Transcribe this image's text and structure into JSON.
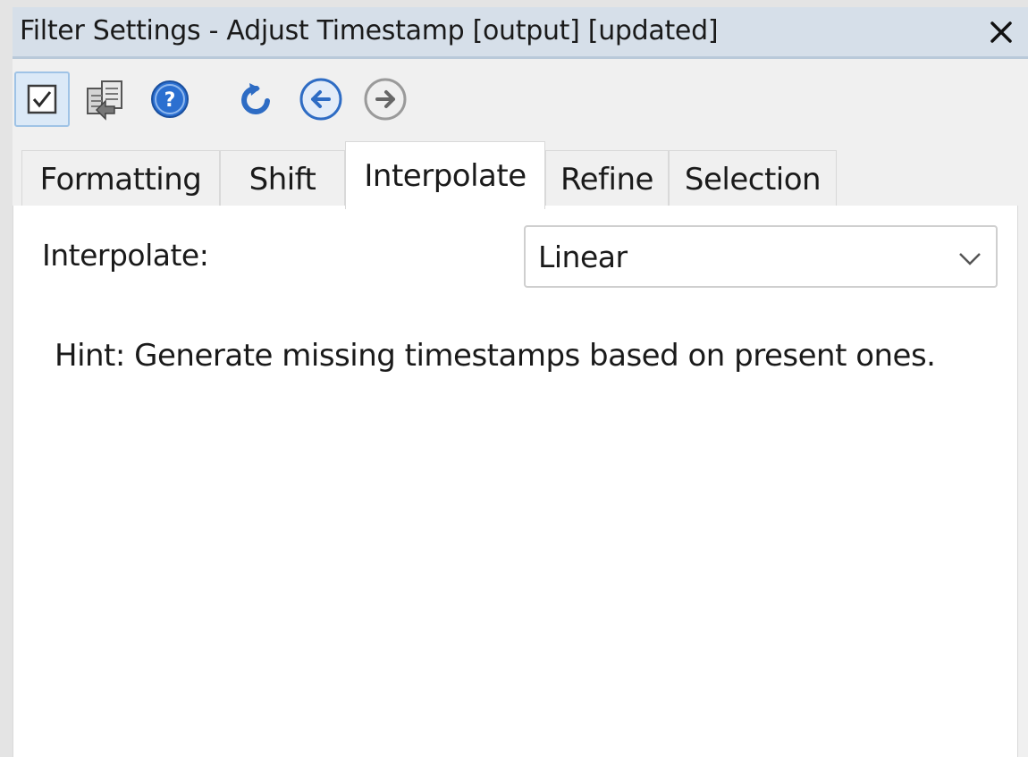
{
  "window": {
    "title": "Filter Settings - Adjust Timestamp [output] [updated]"
  },
  "toolbar": {
    "buttons": [
      {
        "name": "apply",
        "icon": "checkbox-check-icon",
        "active": true
      },
      {
        "name": "copy-settings",
        "icon": "copy-documents-icon"
      },
      {
        "name": "help",
        "icon": "help-icon"
      },
      {
        "name": "reset",
        "icon": "undo-icon"
      },
      {
        "name": "back",
        "icon": "back-arrow-icon"
      },
      {
        "name": "forward",
        "icon": "forward-arrow-icon",
        "disabled": true
      }
    ]
  },
  "tabs": [
    {
      "label": "Formatting"
    },
    {
      "label": "Shift"
    },
    {
      "label": "Interpolate",
      "selected": true
    },
    {
      "label": "Refine"
    },
    {
      "label": "Selection"
    }
  ],
  "interpolate": {
    "label": "Interpolate:",
    "selected_value": "Linear",
    "hint": "Hint: Generate missing timestamps based on present ones."
  },
  "colors": {
    "titlebar": "#d6dfe9",
    "accent": "#1f6fc9",
    "panel": "#ffffff",
    "background": "#f0f0f0"
  }
}
